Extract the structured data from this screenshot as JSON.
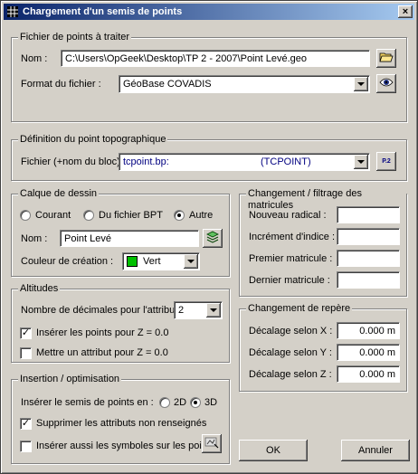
{
  "window": {
    "title": "Chargement d'un semis de points",
    "close_label": "×"
  },
  "fichier_points": {
    "legend": "Fichier de points à traiter",
    "nom_label": "Nom :",
    "nom_value": "C:\\Users\\OpGeek\\Desktop\\TP 2 - 2007\\Point Levé.geo",
    "format_label": "Format du fichier :",
    "format_value": "GéoBase COVADIS"
  },
  "definition_point": {
    "legend": "Définition du point topographique",
    "fichier_label": "Fichier (+nom du bloc) :",
    "fichier_value": "tcpoint.bp:",
    "bloc_value": "(TCPOINT)",
    "btn_text": "P.2"
  },
  "calque": {
    "legend": "Calque de dessin",
    "radio_courant": "Courant",
    "radio_bpt": "Du fichier BPT",
    "radio_autre": "Autre",
    "nom_label": "Nom :",
    "nom_value": "Point Levé",
    "couleur_label": "Couleur de création :",
    "couleur_value": "Vert",
    "couleur_swatch": "#00c000"
  },
  "altitudes": {
    "legend": "Altitudes",
    "decimales_label": "Nombre de décimales pour l'attribut :",
    "decimales_value": "2",
    "inserer_label": "Insérer les points pour Z = 0.0",
    "mettre_label": "Mettre un attribut pour Z = 0.0",
    "inserer_checked": true,
    "mettre_checked": false
  },
  "insertion": {
    "legend": "Insertion / optimisation",
    "semis_label": "Insérer le semis de points en :",
    "radio_2d": "2D",
    "radio_3d": "3D",
    "supprimer_label": "Supprimer les attributs non renseignés",
    "symboles_label": "Insérer aussi les symboles sur les points",
    "supprimer_checked": true,
    "symboles_checked": false
  },
  "matricules": {
    "legend": "Changement / filtrage des matricules",
    "nouveau_label": "Nouveau radical :",
    "increment_label": "Incrément d'indice :",
    "premier_label": "Premier matricule :",
    "dernier_label": "Dernier matricule :",
    "nouveau_value": "",
    "increment_value": "",
    "premier_value": "",
    "dernier_value": ""
  },
  "repere": {
    "legend": "Changement de repère",
    "x_label": "Décalage selon X :",
    "y_label": "Décalage selon Y :",
    "z_label": "Décalage selon Z :",
    "x_value": "0.000 m",
    "y_value": "0.000 m",
    "z_value": "0.000 m"
  },
  "buttons": {
    "ok": "OK",
    "annuler": "Annuler"
  },
  "icons": {
    "app": "grid-icon",
    "browse": "folder-open-icon",
    "view": "eye-icon",
    "calque": "layers-icon",
    "symboles": "symbol-icon"
  }
}
